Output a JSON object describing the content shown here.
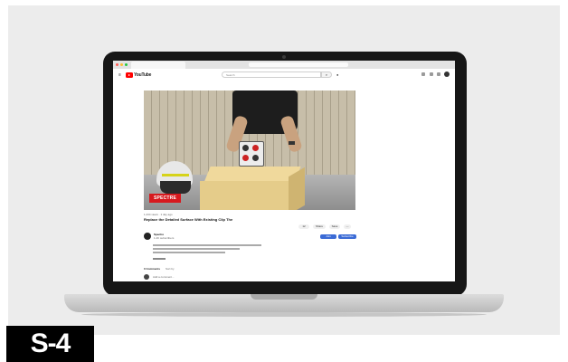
{
  "browser": {
    "tab_title": "",
    "url": ""
  },
  "youtube_header": {
    "logo_text": "YouTube",
    "search_placeholder": "Search"
  },
  "video": {
    "watermark_logo": "SPECTRE",
    "title": "Replace the Detailed Surface With Existing Clip The",
    "meta": "1,234 views · 1 day ago",
    "channel_name": "Spectre",
    "channel_subs": "1.2K subscribers",
    "like_count": "12",
    "share_label": "Share",
    "save_label": "Save",
    "join_label": "Join",
    "subscribe_label": "Subscribe"
  },
  "comments": {
    "header": "0 Comments",
    "sort_label": "Sort by",
    "add_placeholder": "Add a comment..."
  },
  "colors": {
    "yt_red": "#ff0000",
    "brand_red": "#d7191e",
    "subscribe_blue": "#3b6bd6"
  },
  "badge": {
    "label": "S-4"
  }
}
